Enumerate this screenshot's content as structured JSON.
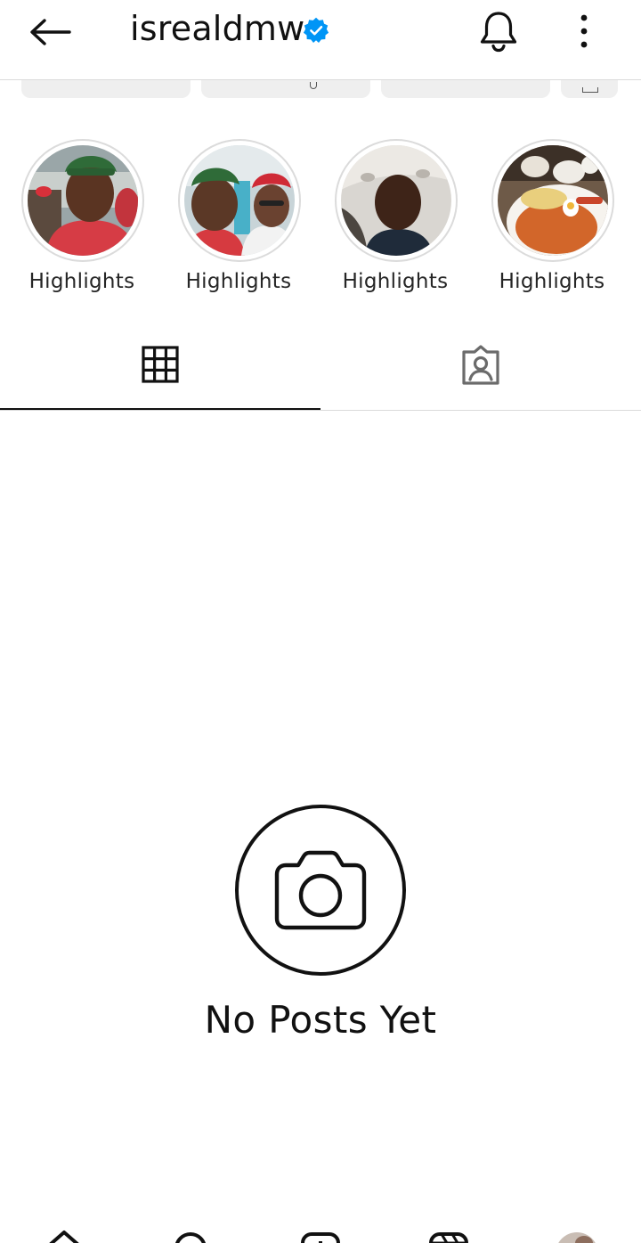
{
  "header": {
    "back_icon": "arrow-left-icon",
    "username": "isrealdmw",
    "verified_icon": "verified-badge-icon",
    "verified_color": "#0095f6",
    "bell_icon": "bell-icon",
    "more_icon": "more-vertical-icon"
  },
  "highlights": [
    {
      "label": "Highlights"
    },
    {
      "label": "Highlights"
    },
    {
      "label": "Highlights"
    },
    {
      "label": "Highlights"
    }
  ],
  "tabs": [
    {
      "icon": "grid-icon",
      "active": true
    },
    {
      "icon": "tagged-person-icon",
      "active": false
    }
  ],
  "empty_state": {
    "icon": "camera-icon",
    "text": "No Posts Yet"
  },
  "bottom_nav": [
    {
      "icon": "home-icon"
    },
    {
      "icon": "search-icon"
    },
    {
      "icon": "add-post-icon"
    },
    {
      "icon": "reels-icon"
    },
    {
      "icon": "profile-avatar-icon"
    }
  ]
}
